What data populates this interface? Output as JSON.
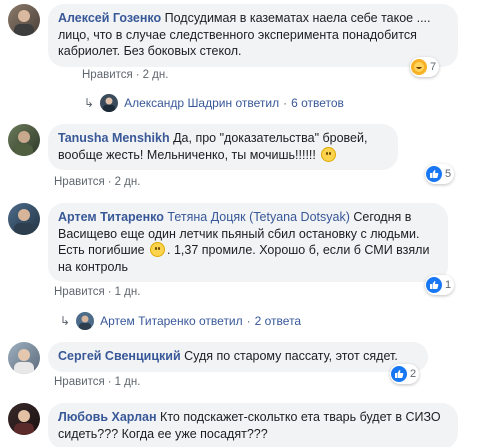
{
  "comments": [
    {
      "author": "Алексей Гозенко",
      "text": "Подсудимая в казематах наела себе такое .... лицо, что в случае следственного эксперимента понадобится кабриолет. Без боковых стекол.",
      "like_label": "Нравится",
      "time": "2 дн.",
      "reaction_count": "7",
      "reaction_icons": [
        "haha-icon",
        "like-icon"
      ],
      "reply": {
        "name": "Александр Шадрин",
        "action": "ответил",
        "count": "6 ответов"
      }
    },
    {
      "author": "Tanusha Menshikh",
      "text_before": "Да, про \"доказательства\" бровей, вообще жесть! Мельниченко, ты мочишь!!!!!!",
      "like_label": "Нравится",
      "time": "2 дн.",
      "reaction_count": "5",
      "reaction_icons": [
        "like-icon"
      ]
    },
    {
      "author": "Артем Титаренко",
      "mention": "Тетяна Доцяк (Tetyana Dotsyak)",
      "text_before": "Сегодня в Васищево еще один летчик пьяный сбил остановку с людьми. Есть погибшие",
      "text_after": ". 1,37 промиле. Хорошо б, если б СМИ взяли на контроль",
      "like_label": "Нравится",
      "time": "1 дн.",
      "reaction_count": "1",
      "reaction_icons": [
        "like-icon"
      ],
      "reply": {
        "name": "Артем Титаренко",
        "action": "ответил",
        "count": "2 ответа"
      }
    },
    {
      "author": "Сергей Свенцицкий",
      "text": "Судя по старому пассату, этот сядет.",
      "like_label": "Нравится",
      "time": "1 дн.",
      "reaction_count": "2",
      "reaction_icons": [
        "like-icon"
      ]
    },
    {
      "author": "Любовь Харлан",
      "text": "Кто подскажет-скольтко ета тварь будет в СИЗО сидеть??? Когда ее уже посадят???"
    }
  ],
  "colors": {
    "link": "#385898",
    "bubble": "#f2f3f5",
    "meta": "#606770",
    "like": "#1877f2"
  }
}
